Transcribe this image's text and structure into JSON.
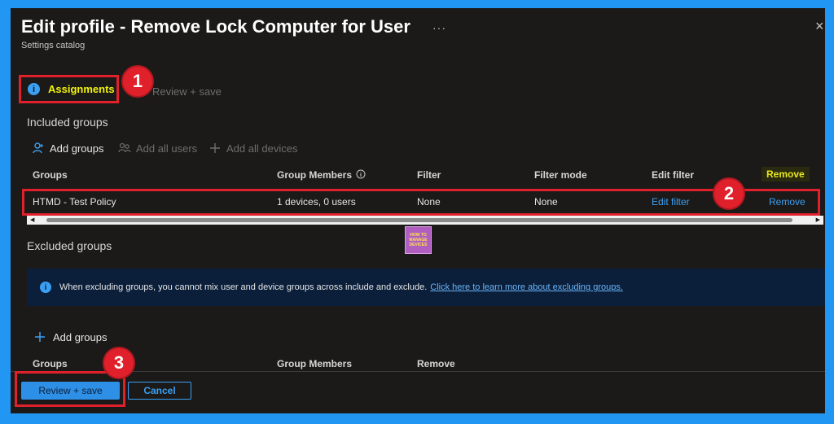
{
  "header": {
    "title": "Edit profile - Remove Lock Computer for User",
    "subtitle": "Settings catalog",
    "more": "···",
    "close": "×"
  },
  "tabs": {
    "active_icon": "i",
    "active_label": "Assignments",
    "next_label": "Review + save"
  },
  "callouts": [
    "1",
    "2",
    "3"
  ],
  "included": {
    "label": "Included groups",
    "commands": {
      "add_groups": "Add groups",
      "add_all_users": "Add all users",
      "add_all_devices": "Add all devices"
    },
    "columns": {
      "groups": "Groups",
      "group_members": "Group Members",
      "filter": "Filter",
      "filter_mode": "Filter mode",
      "edit_filter": "Edit filter",
      "remove": "Remove"
    },
    "rows": [
      {
        "group": "HTMD - Test Policy",
        "members": "1 devices, 0 users",
        "filter": "None",
        "filter_mode": "None",
        "edit_filter": "Edit filter",
        "remove": "Remove"
      }
    ]
  },
  "watermark": {
    "lines": [
      "HOW TO",
      "MANAGE",
      "DEVICES"
    ]
  },
  "excluded": {
    "label": "Excluded groups",
    "info_icon": "i",
    "info_text": "When excluding groups, you cannot mix user and device groups across include and exclude.",
    "info_link": "Click here to learn more about excluding groups.",
    "add_groups": "Add groups",
    "columns": {
      "groups": "Groups",
      "group_members": "Group Members",
      "remove": "Remove"
    }
  },
  "footer": {
    "review_save": "Review + save",
    "cancel": "Cancel"
  },
  "colors": {
    "background": "#2196f3",
    "panel": "#1b1a19",
    "highlight_box": "#e0202a",
    "accent_link": "#3aa0f3",
    "active_tab_text": "#f2f20c"
  }
}
